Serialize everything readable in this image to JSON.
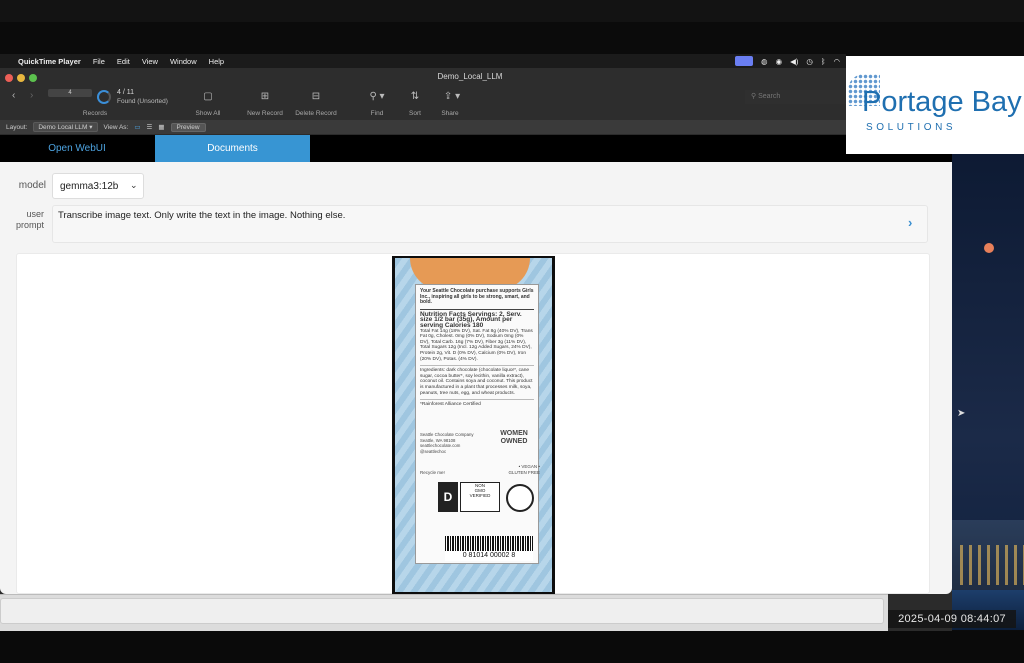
{
  "menubar": {
    "app": "QuickTime Player",
    "items": [
      "File",
      "Edit",
      "View",
      "Window",
      "Help"
    ]
  },
  "window": {
    "title": "Demo_Local_LLM",
    "record_number": "4",
    "found_count": "4 / 11",
    "found_status": "Found (Unsorted)",
    "records_label": "Records",
    "toolbar": [
      {
        "label": "Show All",
        "icon": "show-all-icon"
      },
      {
        "label": "New Record",
        "icon": "new-record-icon"
      },
      {
        "label": "Delete Record",
        "icon": "delete-record-icon"
      },
      {
        "label": "Find",
        "icon": "magnifier-icon"
      },
      {
        "label": "Sort",
        "icon": "sort-icon"
      },
      {
        "label": "Share",
        "icon": "share-icon"
      }
    ],
    "search_placeholder": "Search"
  },
  "layoutbar": {
    "layout_label": "Layout:",
    "layout_value": "Demo Local LLM",
    "view_as_label": "View As:",
    "preview_label": "Preview"
  },
  "tabs": [
    {
      "label": "Open WebUI",
      "active": false
    },
    {
      "label": "Documents",
      "active": true
    }
  ],
  "form": {
    "model_label": "model",
    "model_value": "gemma3:12b",
    "prompt_label_1": "user",
    "prompt_label_2": "prompt",
    "prompt_value": "Transcribe image text. Only write the text in the image. Nothing else."
  },
  "product_label": {
    "head": "Your Seattle Chocolate purchase supports Girls Inc., inspiring all girls to be strong, smart, and bold.",
    "nutrition": "Nutrition Facts Servings: 2, Serv. size 1/2 bar (35g), Amount per serving Calories 180",
    "nutrition_detail": "Total Fat 14g (18% DV), Sat. Fat 8g (40% DV), Trans Fat 0g, Cholest. 0mg (0% DV), Sodium 0mg (0% DV), Total Carb. 16g (7% DV), Fiber 3g (11% DV), Total Sugars 12g (Incl. 12g Added Sugars, 24% DV), Protein 2g, Vit. D (0% DV), Calcium (0% DV), Iron (20% DV), Potas. (4% DV).",
    "ingredients": "Ingredients: dark chocolate (chocolate liquor*, cane sugar, cocoa butter*, soy lecithin, vanilla extract), coconut oil. Contains soya and coconut. This product is manufactured in a plant that processes milk, soya, peanuts, tree nuts, egg, and wheat products.",
    "certified": "*Rainforest Alliance Certified",
    "company": "Seattle Chocolate Company Seattle, WA 98108 seattlechocolate.com @seattlechoc",
    "women_owned": "WOMEN OWNED",
    "vegan": "• VEGAN • GLUTEN FREE",
    "recycle": "Recycle me!",
    "barcode": "0 81014 00002 8"
  },
  "logo": {
    "name": "Portage Bay",
    "sub": "SOLUTIONS"
  },
  "timestamp": "2025-04-09  08:44:07",
  "colors": {
    "accent": "#3795d3",
    "tab_text": "#4da3e0",
    "logo_blue": "#1f6fb0"
  }
}
